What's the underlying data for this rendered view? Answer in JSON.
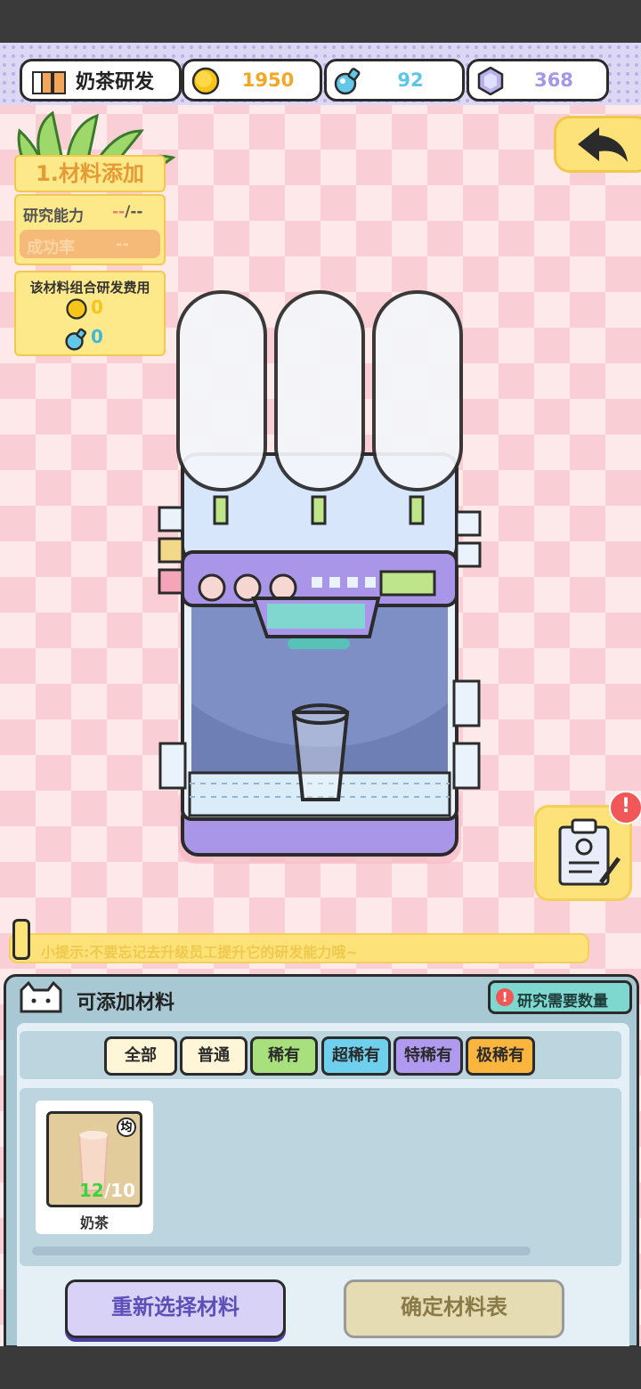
{
  "header": {
    "title": "奶茶研发",
    "coins": "1950",
    "potions": "92",
    "gems": "368"
  },
  "research": {
    "step_title": "1.材料添加",
    "ability_label": "研究能力",
    "ability_value_a": "--",
    "ability_value_b": "/--",
    "success_label": "成功率",
    "success_value": "--",
    "cost_title": "该材料组合研发费用",
    "cost_coins": "0",
    "cost_potions": "0"
  },
  "tip": "小提示:不要忘记去升级员工提升它的研发能力哦~",
  "materials_panel": {
    "title": "可添加材料",
    "need_button": "研究需要数量",
    "tabs": [
      "全部",
      "普通",
      "稀有",
      "超稀有",
      "特稀有",
      "极稀有"
    ],
    "items": [
      {
        "name": "奶茶",
        "have": "12",
        "need": "/10",
        "badge": "均"
      }
    ],
    "reselect_button": "重新选择材料",
    "confirm_button": "确定材料表"
  },
  "colors": {
    "coin": "#f5b21b",
    "potion": "#5bc6e8",
    "gem": "#a596e6",
    "machine_purple": "#a996e8"
  }
}
